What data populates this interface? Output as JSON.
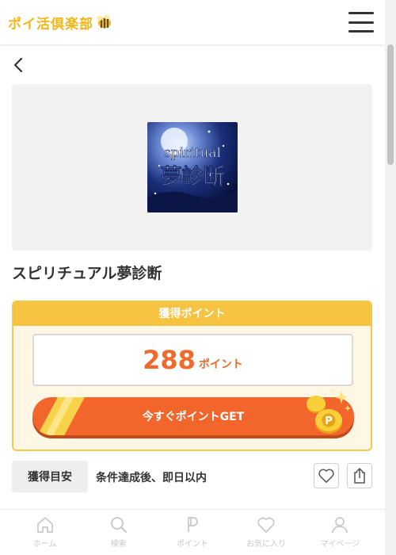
{
  "header": {
    "logo_text": "ポイ活倶楽部",
    "logo_icon": "bee-icon",
    "menu_icon": "hamburger-menu-icon"
  },
  "navigation": {
    "back_icon": "chevron-left-icon"
  },
  "offer": {
    "thumbnail": {
      "line1": "spiritual",
      "line2": "夢診断"
    },
    "title": "スピリチュアル夢診断",
    "points": {
      "header": "獲得ポイント",
      "value": "288",
      "unit": "ポイント"
    },
    "get_button_label": "今すぐポイントGET",
    "eta": {
      "label": "獲得目安",
      "value": "条件達成後、即日以内"
    },
    "actions": {
      "favorite_icon": "heart-icon",
      "share_icon": "share-icon"
    }
  },
  "tabbar": {
    "items": [
      {
        "label": "ホーム",
        "icon": "home-icon"
      },
      {
        "label": "検索",
        "icon": "search-icon"
      },
      {
        "label": "ポイント",
        "icon": "point-icon"
      },
      {
        "label": "お気に入り",
        "icon": "heart-icon"
      },
      {
        "label": "マイページ",
        "icon": "user-icon"
      }
    ]
  },
  "colors": {
    "brand_yellow": "#f5c340",
    "accent_orange": "#f2662b",
    "tab_gray": "#c8c8c8"
  }
}
